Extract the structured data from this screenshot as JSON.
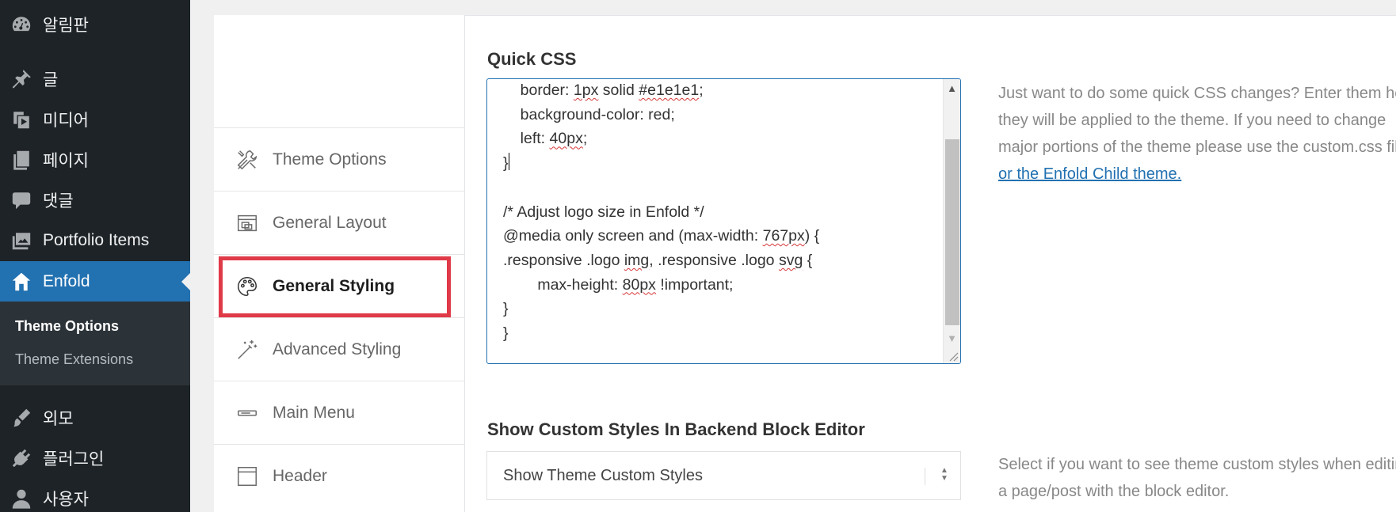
{
  "sidebar": {
    "items": [
      {
        "label": "알림판",
        "icon": "dashboard-icon"
      },
      {
        "label": "글",
        "icon": "pin-icon"
      },
      {
        "label": "미디어",
        "icon": "media-icon"
      },
      {
        "label": "페이지",
        "icon": "pages-icon"
      },
      {
        "label": "댓글",
        "icon": "comments-icon"
      },
      {
        "label": "Portfolio Items",
        "icon": "portfolio-icon"
      },
      {
        "label": "Enfold",
        "icon": "home-icon"
      },
      {
        "label": "외모",
        "icon": "appearance-icon"
      },
      {
        "label": "플러그인",
        "icon": "plugins-icon"
      },
      {
        "label": "사용자",
        "icon": "users-icon"
      }
    ],
    "submenu": [
      {
        "label": "Theme Options"
      },
      {
        "label": "Theme Extensions"
      }
    ]
  },
  "theme_nav": {
    "tabs": [
      {
        "label": "Theme Options",
        "icon": "tools-icon"
      },
      {
        "label": "General Layout",
        "icon": "layout-icon"
      },
      {
        "label": "General Styling",
        "icon": "palette-icon"
      },
      {
        "label": "Advanced Styling",
        "icon": "magic-wand-icon"
      },
      {
        "label": "Main Menu",
        "icon": "menu-bar-icon"
      },
      {
        "label": "Header",
        "icon": "header-icon"
      }
    ]
  },
  "quick_css": {
    "title": "Quick CSS",
    "code": {
      "l1_a": "    border: ",
      "l1_b": "1px",
      "l1_c": " solid ",
      "l1_d": "#e1e1e1",
      "l1_e": ";",
      "l2": "    background-color: red;",
      "l3_a": "    left: ",
      "l3_b": "40px",
      "l3_c": ";",
      "l4": "}",
      "l6": "/* Adjust logo size in Enfold */",
      "l7_a": "@media only screen and (max-width: ",
      "l7_b": "767px",
      "l7_c": ") {",
      "l8_a": ".responsive .logo ",
      "l8_b": "img",
      "l8_c": ", .responsive .logo ",
      "l8_d": "svg",
      "l8_e": " {",
      "l9_a": "        max-height: ",
      "l9_b": "80px",
      "l9_c": " !important;",
      "l10": "}",
      "l11": "}"
    },
    "description": {
      "line1": "Just want to do some quick CSS changes? Enter them here,",
      "line2": "they will be applied to the theme. If you need to change",
      "line3": "major portions of the theme please use the custom.css file",
      "link": "or the Enfold Child theme."
    }
  },
  "custom_styles": {
    "title": "Show Custom Styles In Backend Block Editor",
    "selected": "Show Theme Custom Styles",
    "description": {
      "line1": "Select if you want to see theme custom styles when editing",
      "line2": "a page/post with the block editor."
    }
  },
  "colors": {
    "sidebar_bg": "#1d2327",
    "sidebar_active": "#2271b1",
    "highlight_box": "#e03a48",
    "link": "#2271b1"
  }
}
